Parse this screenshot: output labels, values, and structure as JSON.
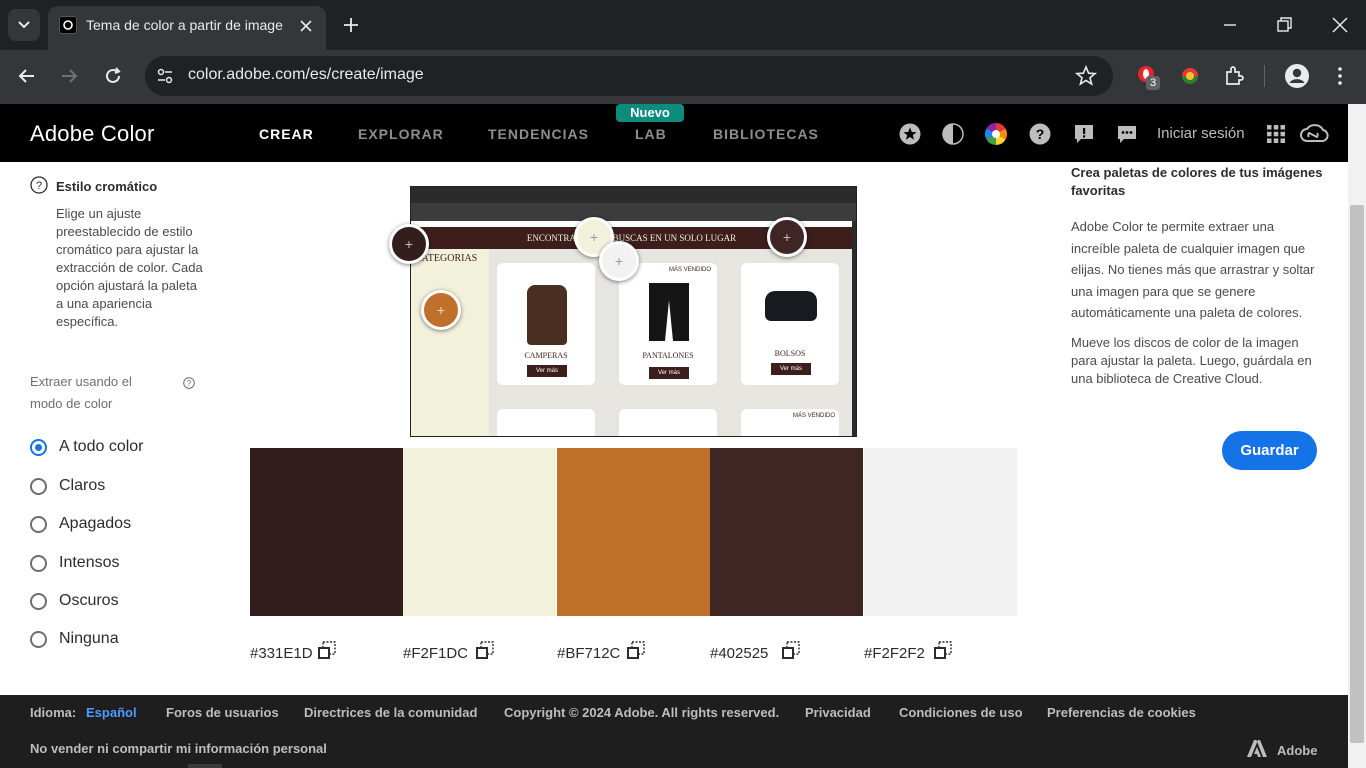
{
  "browser": {
    "tab_title": "Tema de color a partir de image",
    "url": "color.adobe.com/es/create/image",
    "extension_badge": "3"
  },
  "header": {
    "brand": "Adobe Color",
    "nav": [
      {
        "label": "CREAR",
        "active": true
      },
      {
        "label": "EXPLORAR",
        "active": false
      },
      {
        "label": "TENDENCIAS",
        "active": false
      },
      {
        "label": "LAB",
        "active": false
      },
      {
        "label": "BIBLIOTECAS",
        "active": false
      }
    ],
    "badge": "Nuevo",
    "signin": "Iniciar sesión",
    "icons": [
      "star-icon",
      "contrast-icon",
      "color-wheel-icon",
      "help-icon",
      "report-icon",
      "feedback-icon",
      "apps-grid-icon",
      "creative-cloud-icon"
    ]
  },
  "left_panel": {
    "section_title": "Estilo cromático",
    "section_description": "Elige un ajuste preestablecido de estilo cromático para ajustar la extracción de color. Cada opción ajustará la paleta a una apariencia específica.",
    "mode_label": "Extraer usando el modo de color",
    "modes": [
      {
        "label": "A todo color",
        "checked": true
      },
      {
        "label": "Claros",
        "checked": false
      },
      {
        "label": "Apagados",
        "checked": false
      },
      {
        "label": "Intensos",
        "checked": false
      },
      {
        "label": "Oscuros",
        "checked": false
      },
      {
        "label": "Ninguna",
        "checked": false
      }
    ]
  },
  "preview": {
    "banner": "ENCONTRA LO QUE BUSCAS EN UN SOLO LUGAR",
    "sidebar_heading": "CATEGORIAS",
    "products": [
      "CAMPERAS",
      "PANTALONES",
      "BOLSOS"
    ],
    "button": "Ver más",
    "tag": "MÁS VENDIDO"
  },
  "palette": [
    {
      "hex": "#331E1D",
      "color": "#331E1D"
    },
    {
      "hex": "#F2F1DC",
      "color": "#F2F1DC"
    },
    {
      "hex": "#BF712C",
      "color": "#BF712C"
    },
    {
      "hex": "#402525",
      "color": "#402525"
    },
    {
      "hex": "#F2F2F2",
      "color": "#F2F2F2"
    }
  ],
  "right_panel": {
    "title": "Crea paletas de colores de tus imágenes favoritas",
    "p1": "Adobe Color te permite extraer una increíble paleta de cualquier imagen que elijas. No tienes más que arrastrar y soltar una imagen para que se genere automáticamente una paleta de colores.",
    "p2": "Mueve los discos de color de la imagen para ajustar la paleta. Luego, guárdala en una biblioteca de Creative Cloud.",
    "save_label": "Guardar"
  },
  "footer": {
    "language_label": "Idioma:",
    "language_value": "Español",
    "links": [
      "Foros de usuarios",
      "Directrices de la comunidad",
      "Copyright © 2024 Adobe. All rights reserved.",
      "Privacidad",
      "Condiciones de uso",
      "Preferencias de cookies"
    ],
    "donotsell": "No vender ni compartir mi información personal",
    "adobe": "Adobe"
  }
}
